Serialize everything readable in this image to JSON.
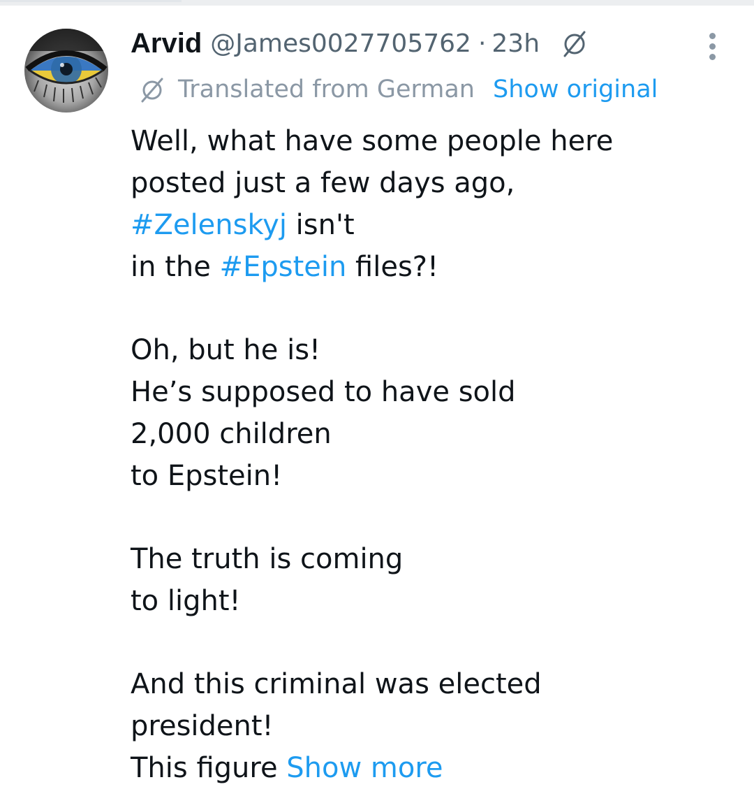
{
  "tweet": {
    "author": {
      "name": "Arvid",
      "handle": "@James0027705762",
      "separator": "·",
      "time": "23h",
      "avatar_icon": "eye-ukraine-flag-avatar",
      "header_icon": "translate-icon"
    },
    "translation": {
      "icon": "translate-icon",
      "label": "Translated from German",
      "show_original": "Show original"
    },
    "body": {
      "p1": {
        "line1": "Well, what have some people here",
        "line2": "posted just a few days ago,",
        "line3_tag": "#Zelenskyj",
        "line3_rest": " isn't",
        "line4_start": "in the ",
        "line4_tag": "#Epstein",
        "line4_end": " files?!"
      },
      "p2": [
        "Oh, but he is!",
        "He’s supposed to have sold",
        "2,000 children",
        "to Epstein!"
      ],
      "p3": [
        "The truth is coming",
        "to light!"
      ],
      "p4": [
        "And this criminal was elected",
        "president!"
      ],
      "last_line": "This figure ",
      "show_more": "Show more"
    },
    "more_menu_icon": "more-vertical-icon"
  },
  "colors": {
    "text": "#0f1419",
    "secondary": "#536471",
    "muted": "#8b98a5",
    "link": "#1d9bf0",
    "flag_blue": "#3a78c2",
    "flag_yellow": "#e9c93a"
  }
}
